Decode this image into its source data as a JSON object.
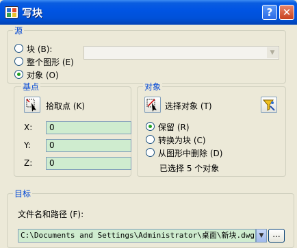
{
  "window": {
    "title": "写块",
    "help_glyph": "?",
    "close_glyph": "✕"
  },
  "source": {
    "legend": "源",
    "block_label": "块 (B):",
    "entire_drawing_label": "整个图形 (E)",
    "objects_label": "对象 (O)",
    "selected": "objects"
  },
  "base_point": {
    "legend": "基点",
    "pick_label": "拾取点 (K)",
    "x_label": "X:",
    "y_label": "Y:",
    "z_label": "Z:",
    "x_value": "0",
    "y_value": "0",
    "z_value": "0"
  },
  "objects": {
    "legend": "对象",
    "select_label": "选择对象 (T)",
    "retain_label": "保留 (R)",
    "convert_label": "转换为块 (C)",
    "delete_label": "从图形中删除 (D)",
    "selected_mode": "retain",
    "count_text": "已选择 5 个对象"
  },
  "destination": {
    "legend": "目标",
    "path_label": "文件名和路径 (F):",
    "path_value": "C:\\Documents and Settings\\Administrator\\桌面\\新块.dwg",
    "browse_label": "..."
  },
  "colors": {
    "legend_blue": "#0046d5",
    "field_green": "#cfeccf",
    "titlebar_blue": "#0054e3",
    "dialog_bg": "#ece9d8"
  },
  "icons": {
    "pick_point": "pick-point-icon",
    "select_objects": "select-objects-icon",
    "quick_select": "quick-select-filter-icon",
    "app": "autocad-app-icon"
  }
}
